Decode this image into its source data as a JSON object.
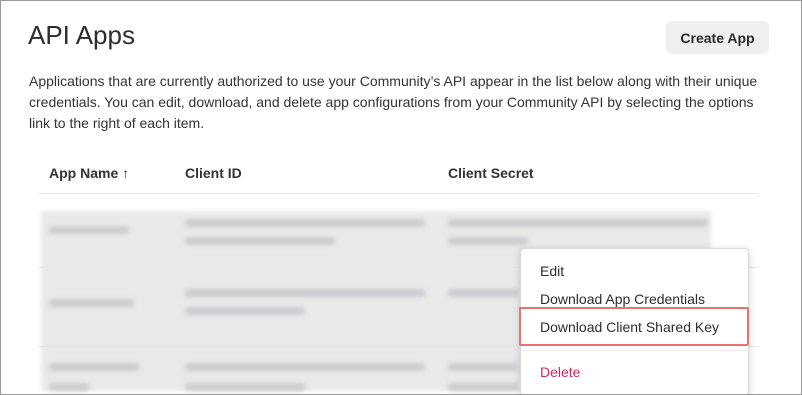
{
  "page": {
    "title": "API Apps",
    "create_button": "Create App",
    "description": "Applications that are currently authorized to use your Community’s API appear in the list below along with their unique credentials. You can edit, download, and delete app configurations from your Community API by selecting the options link to the right of each item."
  },
  "table": {
    "columns": [
      "App Name",
      "Client ID",
      "Client Secret"
    ],
    "sort": {
      "column": "App Name",
      "direction": "ascending",
      "icon": "arrow-up-icon"
    }
  },
  "context_menu": {
    "items": [
      {
        "label": "Edit"
      },
      {
        "label": "Download App Credentials"
      },
      {
        "label": "Download Client Shared Key",
        "highlighted": true
      },
      {
        "label": "Delete",
        "danger": true
      }
    ]
  },
  "colors": {
    "highlight_border": "#e8736a",
    "delete_text": "#d4285b",
    "button_bg": "#efefef"
  }
}
